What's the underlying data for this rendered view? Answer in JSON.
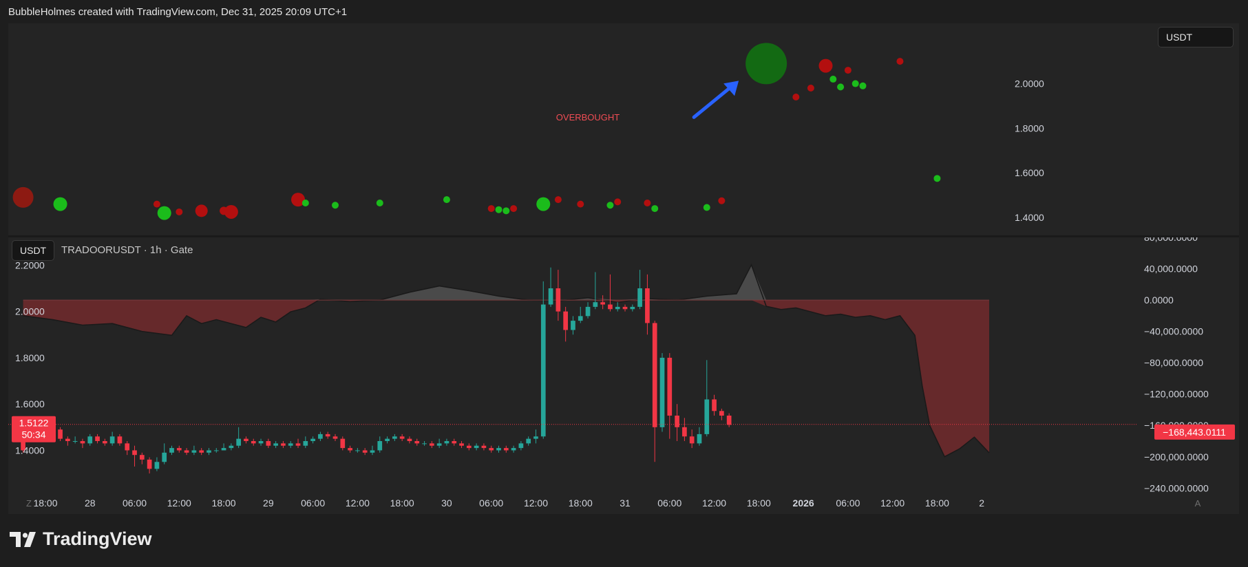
{
  "header": {
    "caption": "BubbleHolmes created with TradingView.com, Dec 31, 2025 20:09 UTC+1"
  },
  "top_panel": {
    "badge": "USDT",
    "annotation": "OVERBOUGHT",
    "colors": {
      "red": "#b30f0f",
      "green": "#1bbc1b",
      "big_green": "#136a13",
      "big_red": "#8d1a12",
      "arrow": "#2962ff",
      "annotation": "#f24d55"
    }
  },
  "bottom_panel": {
    "badge": "USDT",
    "symbol": "TRADOORUSDT · 1h · Gate",
    "price_label": "1.5122",
    "countdown": "50:34",
    "delta_label": "−168,443.0111",
    "colors": {
      "up": "#26a69a",
      "down": "#f23645",
      "fill_red": "#6e2a2c",
      "fill_gray": "#4a4a4a",
      "line": "#1a1a1a"
    }
  },
  "time_axis": {
    "labels": [
      "18:00",
      "28",
      "06:00",
      "12:00",
      "18:00",
      "29",
      "06:00",
      "12:00",
      "18:00",
      "30",
      "06:00",
      "12:00",
      "18:00",
      "31",
      "06:00",
      "12:00",
      "18:00",
      "2026",
      "06:00",
      "12:00",
      "18:00",
      "2"
    ],
    "left_icon": "Z",
    "right_icon": "A"
  },
  "branding": {
    "name": "TradingView",
    "logo_icon": "tradingview-logo-icon"
  },
  "chart_data": [
    {
      "type": "scatter",
      "title": "",
      "ylim": [
        1.32,
        2.27
      ],
      "y_ticks": [
        "2.0000",
        "1.8000",
        "1.6000",
        "1.4000"
      ],
      "y_tick_values": [
        2.0,
        1.8,
        1.6,
        1.4
      ],
      "x_range": [
        -2,
        130
      ],
      "series": [
        {
          "points": [
            {
              "t": 0,
              "y": 1.49,
              "c": "red",
              "s": 15
            },
            {
              "t": 5,
              "y": 1.46,
              "c": "green",
              "s": 10
            },
            {
              "t": 18,
              "y": 1.46,
              "c": "red",
              "s": 5
            },
            {
              "t": 19,
              "y": 1.42,
              "c": "green",
              "s": 10
            },
            {
              "t": 21,
              "y": 1.425,
              "c": "red",
              "s": 5
            },
            {
              "t": 24,
              "y": 1.43,
              "c": "red",
              "s": 9
            },
            {
              "t": 27,
              "y": 1.43,
              "c": "red",
              "s": 6
            },
            {
              "t": 28,
              "y": 1.425,
              "c": "red",
              "s": 10
            },
            {
              "t": 37,
              "y": 1.48,
              "c": "red",
              "s": 10
            },
            {
              "t": 38,
              "y": 1.465,
              "c": "green",
              "s": 5
            },
            {
              "t": 42,
              "y": 1.455,
              "c": "green",
              "s": 5
            },
            {
              "t": 48,
              "y": 1.465,
              "c": "green",
              "s": 5
            },
            {
              "t": 57,
              "y": 1.48,
              "c": "green",
              "s": 5
            },
            {
              "t": 63,
              "y": 1.44,
              "c": "red",
              "s": 5
            },
            {
              "t": 64,
              "y": 1.435,
              "c": "green",
              "s": 5
            },
            {
              "t": 65,
              "y": 1.43,
              "c": "green",
              "s": 5
            },
            {
              "t": 66,
              "y": 1.44,
              "c": "red",
              "s": 5
            },
            {
              "t": 70,
              "y": 1.46,
              "c": "green",
              "s": 10
            },
            {
              "t": 72,
              "y": 1.48,
              "c": "red",
              "s": 5
            },
            {
              "t": 75,
              "y": 1.46,
              "c": "red",
              "s": 5
            },
            {
              "t": 79,
              "y": 1.455,
              "c": "green",
              "s": 5
            },
            {
              "t": 80,
              "y": 1.47,
              "c": "red",
              "s": 5
            },
            {
              "t": 84,
              "y": 1.465,
              "c": "red",
              "s": 5
            },
            {
              "t": 85,
              "y": 1.44,
              "c": "green",
              "s": 5
            },
            {
              "t": 92,
              "y": 1.445,
              "c": "green",
              "s": 5
            },
            {
              "t": 94,
              "y": 1.475,
              "c": "red",
              "s": 5
            },
            {
              "t": 100,
              "y": 2.09,
              "c": "big_green",
              "s": 30
            },
            {
              "t": 104,
              "y": 1.94,
              "c": "red",
              "s": 5
            },
            {
              "t": 106,
              "y": 1.98,
              "c": "red",
              "s": 5
            },
            {
              "t": 108,
              "y": 2.08,
              "c": "red",
              "s": 10
            },
            {
              "t": 109,
              "y": 2.02,
              "c": "green",
              "s": 5
            },
            {
              "t": 110,
              "y": 1.985,
              "c": "green",
              "s": 5
            },
            {
              "t": 111,
              "y": 2.06,
              "c": "red",
              "s": 5
            },
            {
              "t": 112,
              "y": 2.0,
              "c": "green",
              "s": 5
            },
            {
              "t": 113,
              "y": 1.99,
              "c": "green",
              "s": 5
            },
            {
              "t": 118,
              "y": 2.1,
              "c": "red",
              "s": 5
            },
            {
              "t": 123,
              "y": 1.575,
              "c": "green",
              "s": 5
            }
          ]
        }
      ],
      "annotation": {
        "text": "OVERBOUGHT",
        "t": 76,
        "y": 1.835
      }
    },
    {
      "type": "candlestick",
      "title": "",
      "ylim": [
        1.22,
        2.32
      ],
      "y_ticks": [
        "2.2000",
        "2.0000",
        "1.8000",
        "1.6000",
        "1.4000"
      ],
      "y_tick_values": [
        2.2,
        2.0,
        1.8,
        1.6,
        1.4
      ],
      "x_range": [
        -2,
        130
      ],
      "last_price": 1.5122,
      "candles": [
        [
          0,
          1.47,
          1.4,
          1.49,
          1.39
        ],
        [
          1,
          1.45,
          1.47,
          1.49,
          1.44
        ],
        [
          2,
          1.47,
          1.46,
          1.48,
          1.45
        ],
        [
          3,
          1.45,
          1.48,
          1.5,
          1.44
        ],
        [
          4,
          1.48,
          1.49,
          1.52,
          1.47
        ],
        [
          5,
          1.49,
          1.45,
          1.5,
          1.44
        ],
        [
          6,
          1.45,
          1.44,
          1.46,
          1.42
        ],
        [
          7,
          1.44,
          1.44,
          1.46,
          1.43
        ],
        [
          8,
          1.44,
          1.43,
          1.45,
          1.41
        ],
        [
          9,
          1.43,
          1.46,
          1.47,
          1.42
        ],
        [
          10,
          1.46,
          1.44,
          1.47,
          1.43
        ],
        [
          11,
          1.44,
          1.43,
          1.45,
          1.42
        ],
        [
          12,
          1.43,
          1.46,
          1.48,
          1.42
        ],
        [
          13,
          1.46,
          1.43,
          1.47,
          1.42
        ],
        [
          14,
          1.43,
          1.4,
          1.44,
          1.38
        ],
        [
          15,
          1.4,
          1.38,
          1.42,
          1.33
        ],
        [
          16,
          1.38,
          1.36,
          1.39,
          1.34
        ],
        [
          17,
          1.36,
          1.32,
          1.37,
          1.3
        ],
        [
          18,
          1.32,
          1.35,
          1.37,
          1.31
        ],
        [
          19,
          1.35,
          1.39,
          1.43,
          1.34
        ],
        [
          20,
          1.39,
          1.41,
          1.42,
          1.38
        ],
        [
          21,
          1.41,
          1.4,
          1.42,
          1.39
        ],
        [
          22,
          1.4,
          1.39,
          1.41,
          1.38
        ],
        [
          23,
          1.39,
          1.4,
          1.42,
          1.38
        ],
        [
          24,
          1.4,
          1.39,
          1.41,
          1.38
        ],
        [
          25,
          1.39,
          1.4,
          1.41,
          1.38
        ],
        [
          26,
          1.4,
          1.4,
          1.41,
          1.39
        ],
        [
          27,
          1.4,
          1.41,
          1.43,
          1.4
        ],
        [
          28,
          1.41,
          1.42,
          1.43,
          1.4
        ],
        [
          29,
          1.42,
          1.45,
          1.5,
          1.41
        ],
        [
          30,
          1.45,
          1.44,
          1.46,
          1.43
        ],
        [
          31,
          1.44,
          1.43,
          1.45,
          1.42
        ],
        [
          32,
          1.43,
          1.44,
          1.45,
          1.42
        ],
        [
          33,
          1.44,
          1.42,
          1.45,
          1.41
        ],
        [
          34,
          1.42,
          1.43,
          1.44,
          1.41
        ],
        [
          35,
          1.43,
          1.42,
          1.44,
          1.41
        ],
        [
          36,
          1.42,
          1.43,
          1.44,
          1.41
        ],
        [
          37,
          1.43,
          1.42,
          1.45,
          1.41
        ],
        [
          38,
          1.42,
          1.44,
          1.46,
          1.41
        ],
        [
          39,
          1.44,
          1.45,
          1.46,
          1.43
        ],
        [
          40,
          1.45,
          1.47,
          1.48,
          1.44
        ],
        [
          41,
          1.47,
          1.46,
          1.48,
          1.45
        ],
        [
          42,
          1.46,
          1.45,
          1.47,
          1.44
        ],
        [
          43,
          1.45,
          1.41,
          1.46,
          1.4
        ],
        [
          44,
          1.41,
          1.4,
          1.42,
          1.39
        ],
        [
          45,
          1.4,
          1.4,
          1.41,
          1.39
        ],
        [
          46,
          1.4,
          1.39,
          1.41,
          1.38
        ],
        [
          47,
          1.39,
          1.4,
          1.42,
          1.38
        ],
        [
          48,
          1.4,
          1.44,
          1.46,
          1.39
        ],
        [
          49,
          1.44,
          1.45,
          1.46,
          1.43
        ],
        [
          50,
          1.45,
          1.46,
          1.47,
          1.44
        ],
        [
          51,
          1.46,
          1.45,
          1.47,
          1.44
        ],
        [
          52,
          1.45,
          1.44,
          1.46,
          1.43
        ],
        [
          53,
          1.44,
          1.43,
          1.45,
          1.42
        ],
        [
          54,
          1.43,
          1.43,
          1.44,
          1.42
        ],
        [
          55,
          1.43,
          1.42,
          1.44,
          1.41
        ],
        [
          56,
          1.42,
          1.43,
          1.45,
          1.41
        ],
        [
          57,
          1.43,
          1.44,
          1.45,
          1.42
        ],
        [
          58,
          1.44,
          1.43,
          1.45,
          1.42
        ],
        [
          59,
          1.43,
          1.42,
          1.44,
          1.41
        ],
        [
          60,
          1.42,
          1.41,
          1.43,
          1.4
        ],
        [
          61,
          1.41,
          1.42,
          1.43,
          1.4
        ],
        [
          62,
          1.42,
          1.41,
          1.43,
          1.4
        ],
        [
          63,
          1.41,
          1.4,
          1.42,
          1.39
        ],
        [
          64,
          1.4,
          1.41,
          1.42,
          1.39
        ],
        [
          65,
          1.41,
          1.4,
          1.42,
          1.39
        ],
        [
          66,
          1.4,
          1.41,
          1.42,
          1.39
        ],
        [
          67,
          1.41,
          1.43,
          1.44,
          1.4
        ],
        [
          68,
          1.43,
          1.45,
          1.46,
          1.42
        ],
        [
          69,
          1.45,
          1.46,
          1.49,
          1.43
        ],
        [
          70,
          1.46,
          2.03,
          2.13,
          1.45
        ],
        [
          71,
          2.03,
          2.1,
          2.19,
          2.02
        ],
        [
          72,
          2.1,
          2.0,
          2.18,
          1.96
        ],
        [
          73,
          2.0,
          1.92,
          2.02,
          1.87
        ],
        [
          74,
          1.92,
          1.96,
          1.98,
          1.9
        ],
        [
          75,
          1.96,
          1.98,
          2.02,
          1.95
        ],
        [
          76,
          1.98,
          2.02,
          2.04,
          1.97
        ],
        [
          77,
          2.02,
          2.04,
          2.17,
          2.01
        ],
        [
          78,
          2.04,
          2.03,
          2.07,
          2.01
        ],
        [
          79,
          2.03,
          2.01,
          2.16,
          2.0
        ],
        [
          80,
          2.01,
          2.02,
          2.04,
          2.0
        ],
        [
          81,
          2.02,
          2.01,
          2.03,
          2.0
        ],
        [
          82,
          2.01,
          2.02,
          2.03,
          2.0
        ],
        [
          83,
          2.02,
          2.1,
          2.18,
          2.01
        ],
        [
          84,
          2.1,
          1.95,
          2.16,
          1.9
        ],
        [
          85,
          1.95,
          1.5,
          1.96,
          1.35
        ],
        [
          86,
          1.5,
          1.8,
          1.82,
          1.48
        ],
        [
          87,
          1.8,
          1.55,
          1.82,
          1.45
        ],
        [
          88,
          1.55,
          1.5,
          1.6,
          1.44
        ],
        [
          89,
          1.5,
          1.46,
          1.54,
          1.44
        ],
        [
          90,
          1.46,
          1.43,
          1.49,
          1.41
        ],
        [
          91,
          1.43,
          1.47,
          1.5,
          1.42
        ],
        [
          92,
          1.47,
          1.62,
          1.79,
          1.46
        ],
        [
          93,
          1.62,
          1.57,
          1.64,
          1.55
        ],
        [
          94,
          1.57,
          1.55,
          1.58,
          1.53
        ],
        [
          95,
          1.55,
          1.51,
          1.56,
          1.5
        ]
      ]
    },
    {
      "type": "area",
      "title": "",
      "ylim": [
        -245000,
        80000
      ],
      "y_ticks": [
        "80,000.0000",
        "40,000.0000",
        "0.0000",
        "−40,000.0000",
        "−80,000.0000",
        "−120,000.0000",
        "−160,000.0000",
        "−200,000.0000",
        "−240,000.0000"
      ],
      "y_tick_values": [
        80000,
        40000,
        0,
        -40000,
        -80000,
        -120000,
        -160000,
        -200000,
        -240000
      ],
      "x_range": [
        -2,
        130
      ],
      "last_value": -168443.0111,
      "x": [
        0,
        4,
        8,
        12,
        16,
        20,
        22,
        24,
        26,
        28,
        30,
        32,
        34,
        36,
        38,
        40,
        44,
        48,
        52,
        56,
        60,
        64,
        68,
        72,
        76,
        80,
        84,
        88,
        92,
        96,
        98,
        100,
        102,
        104,
        106,
        108,
        110,
        112,
        114,
        116,
        118,
        120,
        121,
        122,
        123,
        124,
        126,
        128,
        130
      ],
      "y": [
        -20000,
        -25000,
        -32000,
        -30000,
        -40000,
        -45000,
        -20000,
        -30000,
        -25000,
        -30000,
        -35000,
        -22000,
        -28000,
        -15000,
        -10000,
        1000,
        -2000,
        0,
        10000,
        18000,
        12000,
        5000,
        0,
        -1000,
        3000,
        -3000,
        2000,
        0,
        5000,
        8000,
        45000,
        -8000,
        -12000,
        -10000,
        -15000,
        -20000,
        -18000,
        -22000,
        -20000,
        -25000,
        -20000,
        -45000,
        -110000,
        -160000,
        -180000,
        -200000,
        -190000,
        -175000,
        -195000
      ]
    }
  ]
}
